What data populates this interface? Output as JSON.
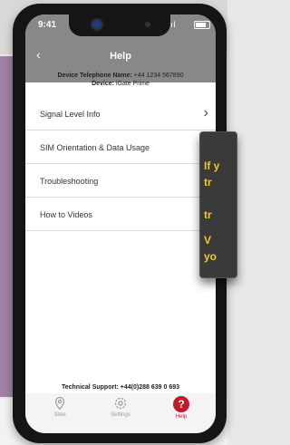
{
  "status": {
    "time": "9:41",
    "signal": "ıl"
  },
  "header": {
    "back_glyph": "‹",
    "title": "Help"
  },
  "device": {
    "phone_label": "Device Telephone Name:",
    "phone_value": "+44 1234 567890",
    "device_label": "Device:",
    "device_value": "iGate Prime"
  },
  "menu": {
    "items": [
      {
        "label": "Signal Level Info",
        "chevron": "›"
      },
      {
        "label": "SIM Orientation & Data Usage"
      },
      {
        "label": "Troubleshooting"
      },
      {
        "label": "How to Videos"
      }
    ]
  },
  "support": {
    "text": "Technical Support: +44(0)288 639 0 693"
  },
  "tabs": [
    {
      "label": "Sites"
    },
    {
      "label": "Settings"
    },
    {
      "label": "Help",
      "glyph": "?"
    }
  ],
  "overlay": {
    "lines": [
      "If y",
      "tr",
      "",
      "tr",
      "",
      "V",
      "yo"
    ]
  }
}
